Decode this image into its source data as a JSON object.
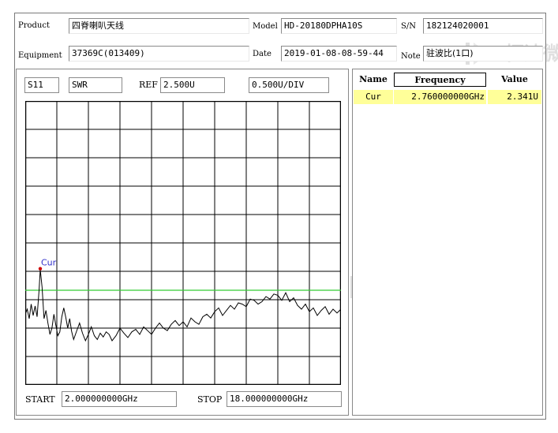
{
  "header": {
    "product_label": "Product",
    "product_value": "四脊喇叭天线",
    "model_label": "Model",
    "model_value": "HD-20180DPHA10S",
    "sn_label": "S/N",
    "sn_value": "182124020001",
    "equipment_label": "Equipment",
    "equipment_value": "37369C(013409)",
    "date_label": "Date",
    "date_value": "2019-01-08-08-59-44",
    "note_label": "Note",
    "note_value": "驻波比(1口)"
  },
  "chart_header": {
    "param": "S11",
    "format": "SWR",
    "ref_label": "REF",
    "ref_value": "2.500U",
    "scale": "0.500U/DIV"
  },
  "footer": {
    "start_label": "START",
    "start_value": "2.000000000GHz",
    "stop_label": "STOP",
    "stop_value": "18.000000000GHz"
  },
  "marker_table": {
    "headers": [
      "Name",
      "Frequency",
      "Value"
    ],
    "rows": [
      {
        "name": "Cur",
        "frequency": "2.760000000GHz",
        "value": "2.341U"
      }
    ]
  },
  "watermark": {
    "cn": "恒达微波",
    "en": "HENGDA MICROWAVE"
  },
  "colors": {
    "trace": "#000000",
    "limit_line": "#33cc33",
    "marker": "#cc0000",
    "marker_label": "#3333cc",
    "highlight_row": "#ffff99"
  },
  "chart_data": {
    "type": "line",
    "title": "",
    "xlabel": "",
    "ylabel": "",
    "xlim": [
      2.0,
      18.0
    ],
    "ylim": [
      0.5,
      5.0
    ],
    "x_unit": "GHz",
    "y_unit": "U",
    "ref_level": 2.5,
    "per_div": 0.5,
    "limit_line": 2.0,
    "grid": true,
    "marker": {
      "name": "Cur",
      "x": 2.76,
      "y": 2.341
    },
    "series": [
      {
        "x": [
          2.0,
          2.1,
          2.2,
          2.3,
          2.4,
          2.5,
          2.6,
          2.7,
          2.76,
          2.85,
          2.95,
          3.05,
          3.15,
          3.25,
          3.35,
          3.45,
          3.55,
          3.65,
          3.75,
          3.85,
          3.95,
          4.05,
          4.15,
          4.25,
          4.35,
          4.45,
          4.6,
          4.75,
          4.9,
          5.05,
          5.2,
          5.35,
          5.5,
          5.65,
          5.8,
          5.95,
          6.1,
          6.25,
          6.4,
          6.6,
          6.8,
          7.0,
          7.2,
          7.4,
          7.6,
          7.8,
          8.0,
          8.2,
          8.4,
          8.6,
          8.8,
          9.0,
          9.2,
          9.4,
          9.6,
          9.8,
          10.0,
          10.2,
          10.4,
          10.6,
          10.8,
          11.0,
          11.2,
          11.4,
          11.6,
          11.8,
          12.0,
          12.2,
          12.4,
          12.6,
          12.8,
          13.0,
          13.2,
          13.4,
          13.6,
          13.8,
          14.0,
          14.2,
          14.4,
          14.6,
          14.8,
          15.0,
          15.2,
          15.4,
          15.6,
          15.8,
          16.0,
          16.2,
          16.4,
          16.6,
          16.8,
          17.0,
          17.2,
          17.4,
          17.6,
          17.8,
          18.0
        ],
        "values": [
          1.62,
          1.7,
          1.55,
          1.78,
          1.6,
          1.75,
          1.58,
          2.0,
          2.33,
          2.05,
          1.55,
          1.68,
          1.48,
          1.3,
          1.4,
          1.62,
          1.45,
          1.28,
          1.34,
          1.58,
          1.72,
          1.58,
          1.4,
          1.55,
          1.35,
          1.22,
          1.35,
          1.48,
          1.32,
          1.2,
          1.3,
          1.42,
          1.28,
          1.22,
          1.32,
          1.26,
          1.34,
          1.3,
          1.2,
          1.28,
          1.4,
          1.32,
          1.25,
          1.34,
          1.38,
          1.3,
          1.42,
          1.36,
          1.3,
          1.4,
          1.48,
          1.4,
          1.36,
          1.46,
          1.52,
          1.44,
          1.5,
          1.42,
          1.56,
          1.5,
          1.46,
          1.58,
          1.62,
          1.56,
          1.66,
          1.72,
          1.6,
          1.68,
          1.76,
          1.7,
          1.8,
          1.78,
          1.74,
          1.86,
          1.84,
          1.78,
          1.82,
          1.9,
          1.86,
          1.94,
          1.92,
          1.84,
          1.96,
          1.82,
          1.88,
          1.76,
          1.7,
          1.78,
          1.66,
          1.72,
          1.6,
          1.68,
          1.74,
          1.62,
          1.7,
          1.64,
          1.7
        ]
      }
    ]
  }
}
